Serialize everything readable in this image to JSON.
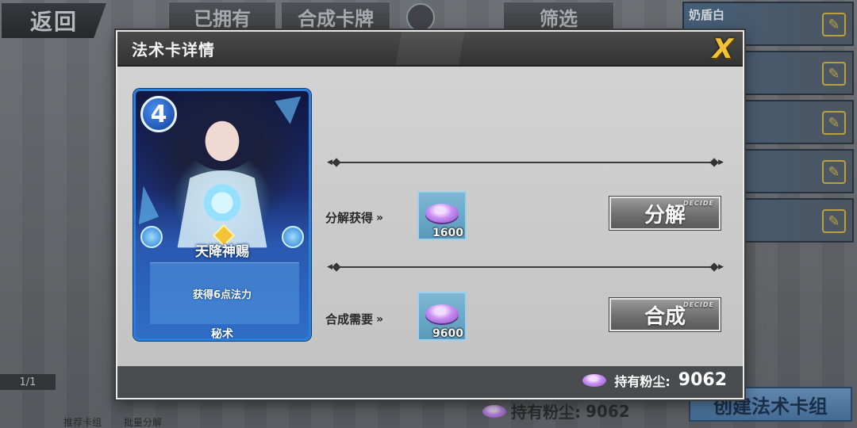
{
  "background": {
    "back_label": "返回",
    "tabs": [
      "已拥有",
      "合成卡牌",
      "筛选"
    ],
    "deck_first_name": "奶盾白",
    "page_indicator": "1/1",
    "bottom_icons": [
      "推荐卡组",
      "批量分解"
    ],
    "dust_label": "持有粉尘:",
    "dust_value": "9062",
    "create_deck_label": "创建法术卡组"
  },
  "modal": {
    "title": "法术卡详情",
    "close_label": "X",
    "card": {
      "cost": "4",
      "name": "天降神赐",
      "description": "获得6点法力",
      "type": "秘术"
    },
    "disenchant": {
      "label": "分解获得",
      "arrow": "»",
      "amount": "1600",
      "button_label": "分解",
      "button_tag": "DECIDE"
    },
    "craft": {
      "label": "合成需要",
      "arrow": "»",
      "amount": "9600",
      "button_label": "合成",
      "button_tag": "DECIDE"
    },
    "footer": {
      "dust_label": "持有粉尘:",
      "dust_value": "9062"
    }
  },
  "colors": {
    "accent_gold": "#f2c232",
    "card_border": "#2c7fd6",
    "dust_purple": "#c98ff2"
  }
}
